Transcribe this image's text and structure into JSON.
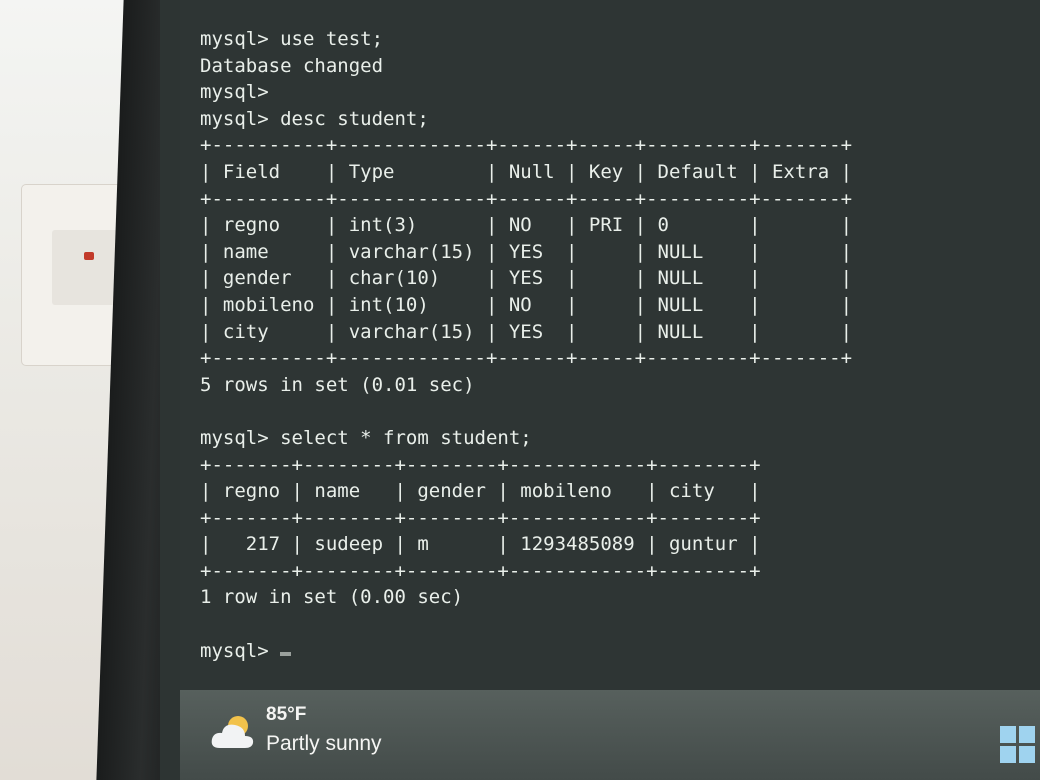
{
  "terminal": {
    "lines": [
      "mysql> use test;",
      "Database changed",
      "mysql>",
      "mysql> desc student;",
      "+----------+-------------+------+-----+---------+-------+",
      "| Field    | Type        | Null | Key | Default | Extra |",
      "+----------+-------------+------+-----+---------+-------+",
      "| regno    | int(3)      | NO   | PRI | 0       |       |",
      "| name     | varchar(15) | YES  |     | NULL    |       |",
      "| gender   | char(10)    | YES  |     | NULL    |       |",
      "| mobileno | int(10)     | NO   |     | NULL    |       |",
      "| city     | varchar(15) | YES  |     | NULL    |       |",
      "+----------+-------------+------+-----+---------+-------+",
      "5 rows in set (0.01 sec)",
      "",
      "mysql> select * from student;",
      "+-------+--------+--------+------------+--------+",
      "| regno | name   | gender | mobileno   | city   |",
      "+-------+--------+--------+------------+--------+",
      "|   217 | sudeep | m      | 1293485089 | guntur |",
      "+-------+--------+--------+------------+--------+",
      "1 row in set (0.00 sec)",
      ""
    ],
    "prompt": "mysql> "
  },
  "taskbar": {
    "weather_temp": "85°F",
    "weather_condition": "Partly sunny",
    "weather_icon": "cloud-sun-icon",
    "start_icon": "windows-start-icon"
  },
  "colors": {
    "terminal_bg": "#2e3534",
    "terminal_text": "#e9efea",
    "taskbar_bg": "#4f5856",
    "start_icon": "#9fd3ef"
  }
}
